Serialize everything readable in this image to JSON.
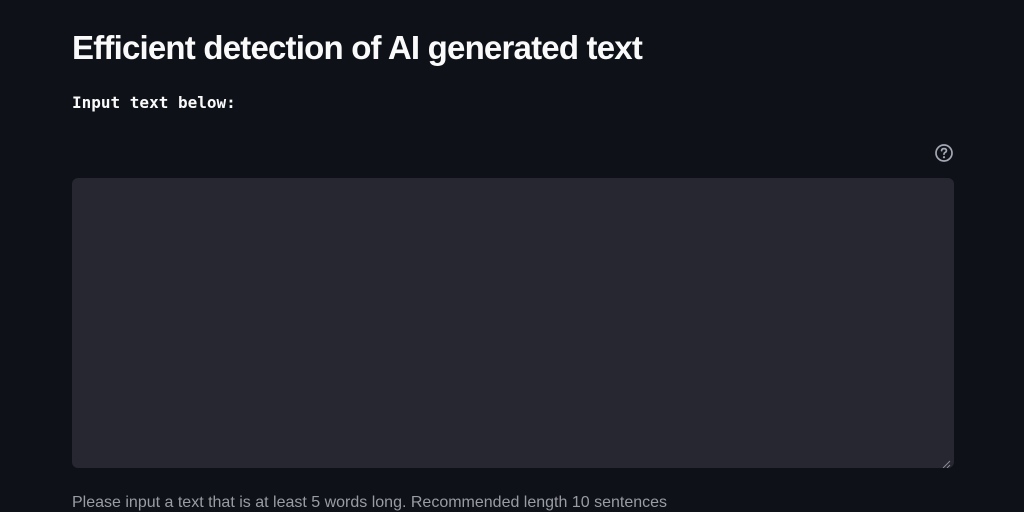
{
  "header": {
    "title": "Efficient detection of AI generated text"
  },
  "input": {
    "label": "Input text below:",
    "value": "",
    "help_icon": "question-circle-icon",
    "resize_icon": "resize-handle-icon"
  },
  "caption": {
    "text": "Please input a text that is at least 5 words long. Recommended length 10 sentences"
  },
  "colors": {
    "background": "#0e1117",
    "text_area_background": "#262730",
    "text": "#fafafa",
    "caption": "#9a9ca3"
  }
}
